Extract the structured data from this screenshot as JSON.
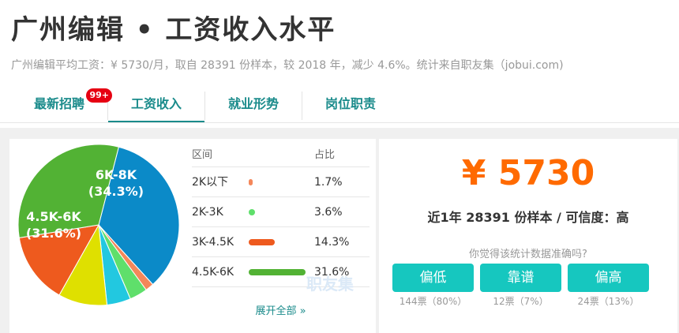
{
  "header": {
    "title": "广州编辑 • 工资收入水平",
    "subtitle": "广州编辑平均工资：¥ 5730/月，取自 28391 份样本，较 2018 年，减少 4.6%。统计来自职友集（jobui.com)"
  },
  "tabs": [
    {
      "label": "最新招聘",
      "badge": "99+"
    },
    {
      "label": "工资收入"
    },
    {
      "label": "就业形势"
    },
    {
      "label": "岗位职责"
    }
  ],
  "chart_data": {
    "type": "pie",
    "slices": [
      {
        "label": "6K-8K",
        "value": 34.3,
        "color": "#0b8ac8"
      },
      {
        "label": "",
        "value": 1.7,
        "color": "#f4875a"
      },
      {
        "label": "",
        "value": 3.6,
        "color": "#5fdf6b"
      },
      {
        "label": "",
        "value": 4.8,
        "color": "#22c8e0"
      },
      {
        "label": "",
        "value": 9.8,
        "color": "#dfe000"
      },
      {
        "label": "",
        "value": 14.3,
        "color": "#ee5a1e"
      },
      {
        "label": "4.5K-6K",
        "value": 31.6,
        "color": "#52b234"
      }
    ]
  },
  "table": {
    "headers": [
      "区间",
      "占比"
    ],
    "rows": [
      {
        "range": "2K以下",
        "percent": "1.7%",
        "value": 1.7,
        "color": "#f4875a"
      },
      {
        "range": "2K-3K",
        "percent": "3.6%",
        "value": 3.6,
        "color": "#5fdf6b"
      },
      {
        "range": "3K-4.5K",
        "percent": "14.3%",
        "value": 14.3,
        "color": "#ee5a1e"
      },
      {
        "range": "4.5K-6K",
        "percent": "31.6%",
        "value": 31.6,
        "color": "#52b234"
      }
    ],
    "expand_label": "展开全部 »",
    "watermark": "职友集"
  },
  "summary": {
    "salary": "¥ 5730",
    "sample": "近1年 28391 份样本 / 可信度：高",
    "question": "你觉得该统计数据准确吗?",
    "votes": [
      {
        "label": "偏低",
        "count": "144票（80%）"
      },
      {
        "label": "靠谱",
        "count": "12票（7%）"
      },
      {
        "label": "偏高",
        "count": "24票（13%）"
      }
    ]
  }
}
